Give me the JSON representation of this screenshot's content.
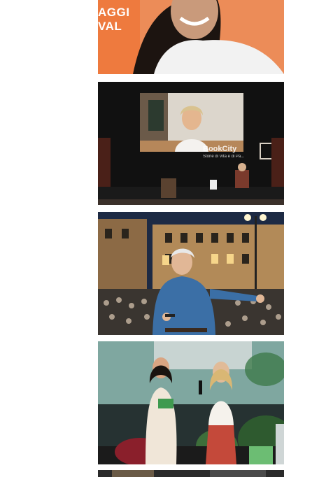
{
  "gallery": {
    "photos": [
      {
        "alt": "Woman with long dark hair smiling against an orange backdrop",
        "overlay_lines": [
          "AGGI",
          "VAL"
        ],
        "colors": {
          "backdrop": "#ee7a3e",
          "shirt": "#f2f2f2"
        }
      },
      {
        "alt": "Stage with large video screen showing a smiling woman on a video call",
        "stage_brand": "BookCity",
        "stage_caption": "Storie di Vita e di Pa...",
        "colors": {
          "stage": "#111111",
          "screen": "#e9e6e1"
        }
      },
      {
        "alt": "Older man with microphone in blue shirt on stage before a large crowd in a piazza at dusk",
        "colors": {
          "sky": "#1d2a44",
          "building": "#b28a58",
          "shirt": "#3b6fa6"
        }
      },
      {
        "alt": "Two women on stage, one in white dress holding a green book, another with microphone",
        "colors": {
          "screen": "#7fa7a0",
          "dress": "#f0e6d8",
          "skirt": "#c4493a"
        }
      },
      {
        "alt": "Partially visible photo at bottom of gallery"
      }
    ]
  }
}
